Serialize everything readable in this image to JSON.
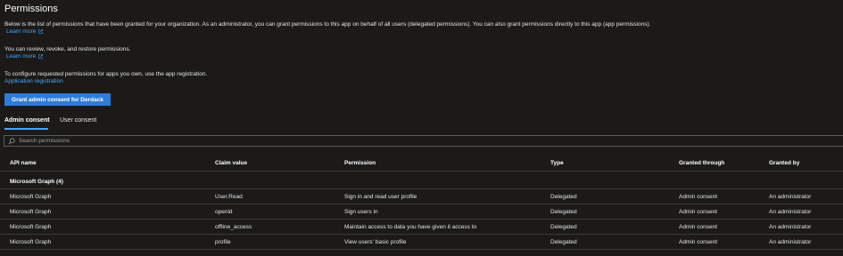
{
  "header": {
    "title": "Permissions"
  },
  "intro": {
    "text1": "Below is the list of permissions that have been granted for your organization. As an administrator, you can grant permissions to this app on behalf of all users (delegated permissions). You can also grant permissions directly to this app (app permissions).",
    "learn_more_1": "Learn more",
    "text2": "You can review, revoke, and restore permissions.",
    "learn_more_2": "Learn more",
    "text3": "To configure requested permissions for apps you own, use the app registration.",
    "app_registration_link": "Application registration"
  },
  "actions": {
    "grant_button_label": "Grant admin consent for Derdack"
  },
  "tabs": [
    {
      "label": "Admin consent",
      "active": true
    },
    {
      "label": "User consent",
      "active": false
    }
  ],
  "search": {
    "placeholder": "Search permissions",
    "value": ""
  },
  "table": {
    "columns": [
      "API name",
      "Claim value",
      "Permission",
      "Type",
      "Granted through",
      "Granted by"
    ],
    "group_label": "Microsoft Graph (4)",
    "rows": [
      {
        "api": "Microsoft Graph",
        "claim": "User.Read",
        "permission": "Sign in and read user profile",
        "type": "Delegated",
        "granted_through": "Admin consent",
        "granted_by": "An administrator"
      },
      {
        "api": "Microsoft Graph",
        "claim": "openid",
        "permission": "Sign users in",
        "type": "Delegated",
        "granted_through": "Admin consent",
        "granted_by": "An administrator"
      },
      {
        "api": "Microsoft Graph",
        "claim": "offline_access",
        "permission": "Maintain access to data you have given it access to",
        "type": "Delegated",
        "granted_through": "Admin consent",
        "granted_by": "An administrator"
      },
      {
        "api": "Microsoft Graph",
        "claim": "profile",
        "permission": "View users' basic profile",
        "type": "Delegated",
        "granted_through": "Admin consent",
        "granted_by": "An administrator"
      }
    ]
  },
  "icons": {
    "external_link": "external-link-icon",
    "search": "search-icon"
  },
  "colors": {
    "background": "#1b1a19",
    "link": "#4aa4f5",
    "primary_button": "#2f7bd8",
    "active_tab_underline": "#4aa4f5"
  }
}
